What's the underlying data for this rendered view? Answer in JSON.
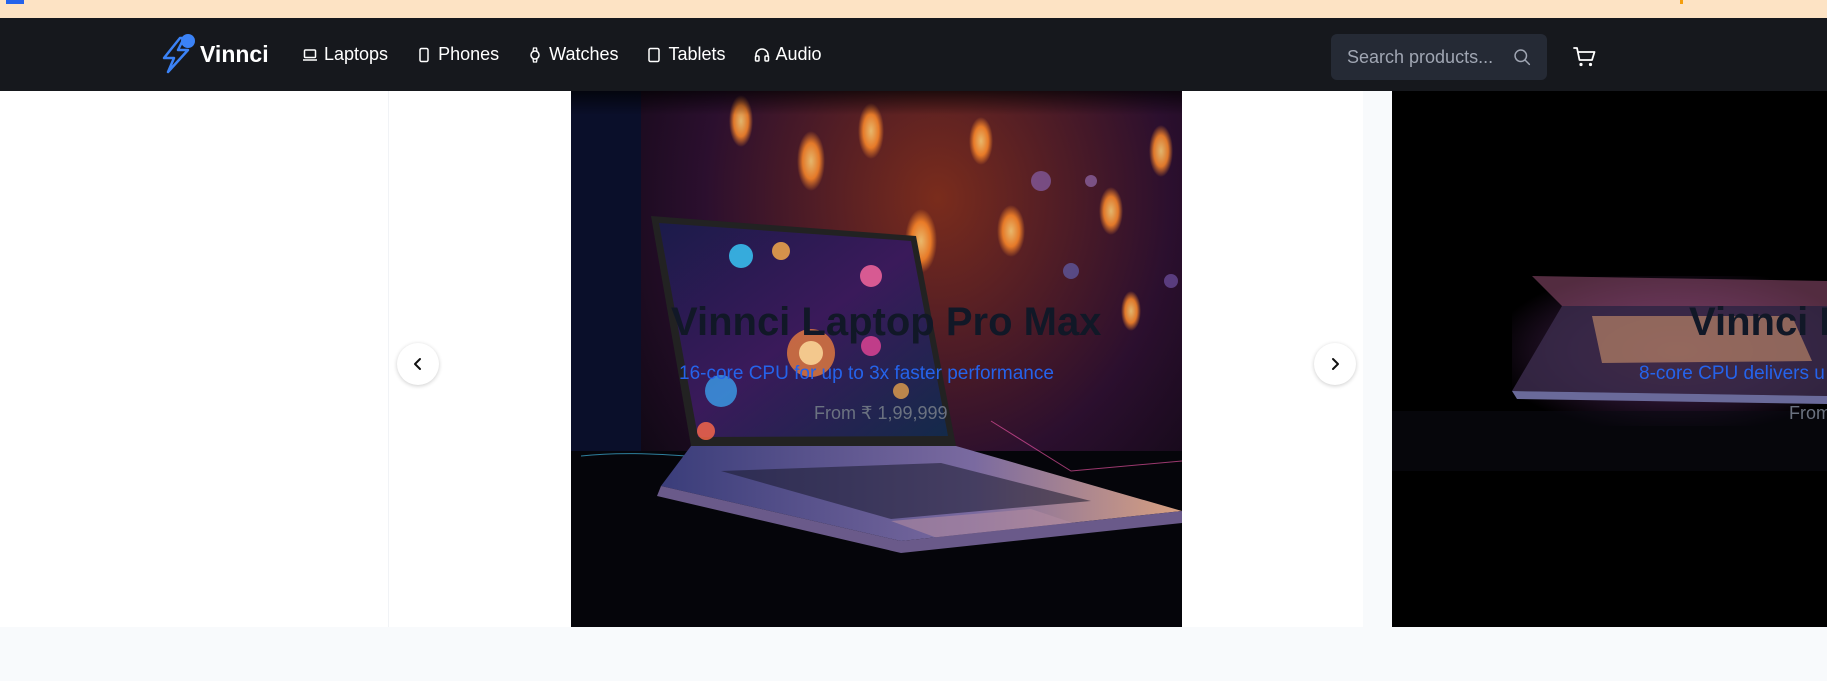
{
  "brand": {
    "name": "Vinnci",
    "accent": "#3b82f6"
  },
  "nav": {
    "items": [
      {
        "label": "Laptops",
        "icon": "laptop-icon"
      },
      {
        "label": "Phones",
        "icon": "phone-icon"
      },
      {
        "label": "Watches",
        "icon": "watch-icon"
      },
      {
        "label": "Tablets",
        "icon": "tablet-icon"
      },
      {
        "label": "Audio",
        "icon": "headphones-icon"
      }
    ],
    "search_placeholder": "Search products...",
    "cart_icon": "cart-icon"
  },
  "carousel": {
    "slides": [
      {
        "title": "Vinnci Laptop Pro Max",
        "subtitle": "16-core CPU for up to 3x faster performance",
        "price": "From ₹ 1,99,999"
      },
      {
        "title": "Vinnci L",
        "subtitle": "8-core CPU delivers u",
        "price": "From"
      }
    ]
  }
}
